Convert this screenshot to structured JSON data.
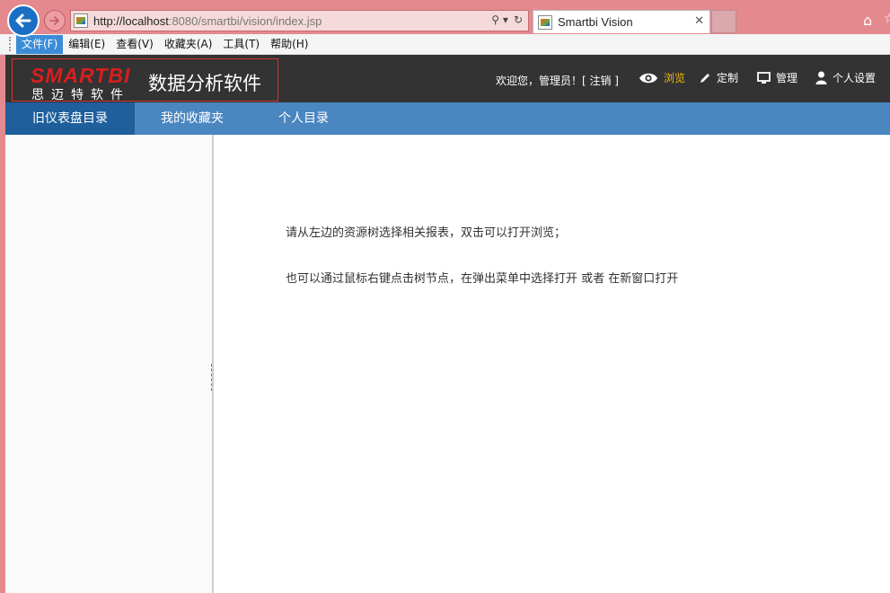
{
  "browser": {
    "url_host": "http://localhost",
    "url_rest": ":8080/smartbi/vision/index.jsp",
    "tab_title": "Smartbi Vision",
    "tab_close": "✕",
    "search_glyph": "⚲ ▾",
    "refresh_glyph": "↻",
    "home_glyph": "⌂",
    "fav_glyph": "☆"
  },
  "menubar": {
    "items": [
      "文件(F)",
      "编辑(E)",
      "查看(V)",
      "收藏夹(A)",
      "工具(T)",
      "帮助(H)"
    ],
    "active_index": 0
  },
  "header": {
    "logo_word": "SMARTBI",
    "logo_cn": "思迈特软件",
    "title": "数据分析软件",
    "welcome": "欢迎您，管理员！[ 注销 ]",
    "nav": {
      "browse": "浏览",
      "customize": "定制",
      "manage": "管理",
      "settings": "个人设置"
    },
    "accent": "#f2b705"
  },
  "tabs": [
    {
      "label": "旧仪表盘目录",
      "active": true
    },
    {
      "label": "我的收藏夹",
      "active": false
    },
    {
      "label": "个人目录",
      "active": false
    }
  ],
  "main": {
    "line1": "请从左边的资源树选择相关报表，双击可以打开浏览；",
    "line2": "也可以通过鼠标右键点击树节点，在弹出菜单中选择打开 或者 在新窗口打开"
  }
}
